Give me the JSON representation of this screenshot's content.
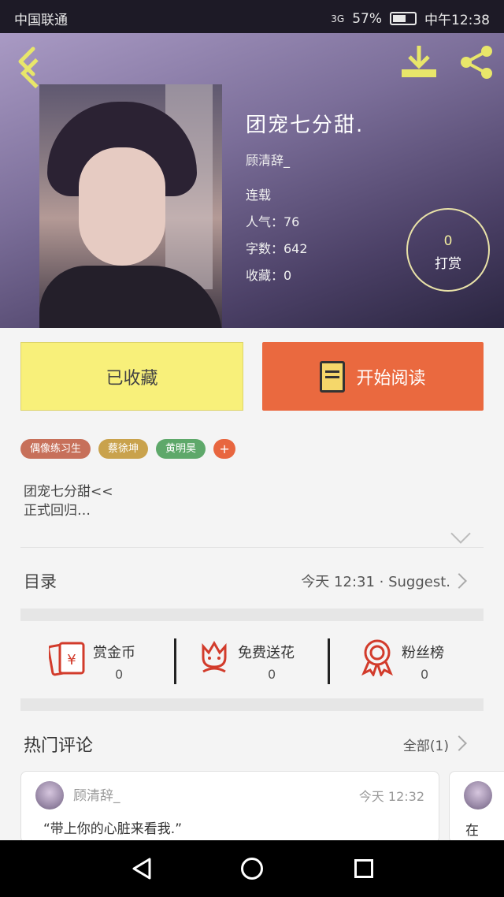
{
  "status_bar": {
    "carrier": "中国联通",
    "network": "3G",
    "battery": "57%",
    "time": "中午12:38"
  },
  "header": {
    "icons": {
      "back": "back-arrow-icon",
      "download": "download-icon",
      "share": "share-icon"
    },
    "title": "团宠七分甜.",
    "author": "顾清辞_",
    "status": "连载",
    "popularity": "人气：76",
    "word_count": "字数：642",
    "favorites": "收藏：0",
    "tip": {
      "count": "0",
      "label": "打赏"
    }
  },
  "actions": {
    "favorite_label": "已收藏",
    "read_label": "开始阅读"
  },
  "tags": [
    {
      "label": "偶像练习生",
      "color": "#c7705a"
    },
    {
      "label": "蔡徐坤",
      "color": "#c9a24c"
    },
    {
      "label": "黄明昊",
      "color": "#5ea86a"
    },
    {
      "label": "+",
      "color": "#e8663f"
    }
  ],
  "description": {
    "line1": "团宠七分甜<<",
    "line2": "正式回归…"
  },
  "toc": {
    "label": "目录",
    "meta": "今天 12:31 · Suggest."
  },
  "stats": [
    {
      "label": "赏金币",
      "value": "0",
      "icon": "red-envelope-icon"
    },
    {
      "label": "免费送花",
      "value": "0",
      "icon": "flower-icon"
    },
    {
      "label": "粉丝榜",
      "value": "0",
      "icon": "medal-icon"
    }
  ],
  "hot_comments": {
    "label": "热门评论",
    "all": "全部(1)",
    "comment": {
      "user": "顾清辞_",
      "time": "今天 12:32",
      "text": "“带上你的心脏来看我.”"
    },
    "next_preview": "在"
  },
  "colors": {
    "accent_yellow": "#f8f07a",
    "accent_orange": "#ea693f",
    "icon_yellow": "#e8e66a"
  }
}
